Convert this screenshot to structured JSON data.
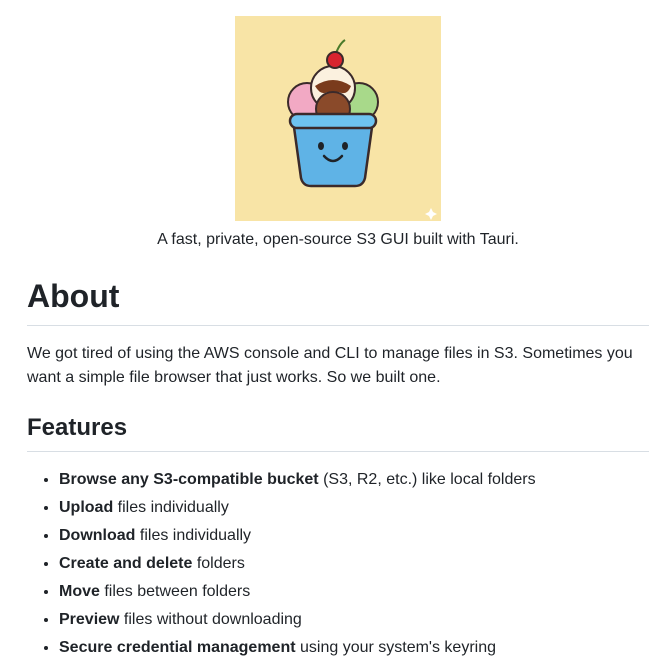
{
  "hero": {
    "image_icon": "ice-cream-bucket-logo",
    "background_color": "#f8e4a6",
    "tagline": "A fast, private, open-source S3 GUI built with Tauri."
  },
  "about": {
    "heading": "About",
    "text": "We got tired of using the AWS console and CLI to manage files in S3. Sometimes you want a simple file browser that just works. So we built one."
  },
  "features": {
    "heading": "Features",
    "items": [
      {
        "bold": "Browse any S3-compatible bucket",
        "rest": " (S3, R2, etc.) like local folders"
      },
      {
        "bold": "Upload",
        "rest": " files individually"
      },
      {
        "bold": "Download",
        "rest": " files individually"
      },
      {
        "bold": "Create and delete",
        "rest": " folders"
      },
      {
        "bold": "Move",
        "rest": " files between folders"
      },
      {
        "bold": "Preview",
        "rest": " files without downloading"
      },
      {
        "bold": "Secure credential management",
        "rest": " using your system's keyring"
      }
    ]
  }
}
